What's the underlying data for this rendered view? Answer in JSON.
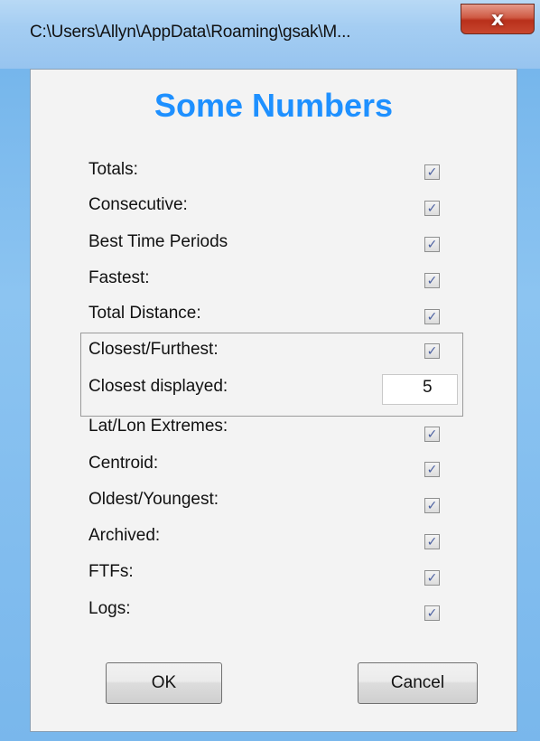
{
  "window": {
    "title": "C:\\Users\\Allyn\\AppData\\Roaming\\gsak\\M...",
    "close_label": "x"
  },
  "dialog": {
    "heading": "Some Numbers",
    "options": [
      {
        "label": "Totals:",
        "checked": true
      },
      {
        "label": "Consecutive:",
        "checked": true
      },
      {
        "label": "Best Time Periods",
        "checked": true
      },
      {
        "label": "Fastest:",
        "checked": true
      },
      {
        "label": "Total Distance:",
        "checked": true
      },
      {
        "label": "Closest/Furthest:",
        "checked": true
      },
      {
        "label": "Lat/Lon Extremes:",
        "checked": true
      },
      {
        "label": "Centroid:",
        "checked": true
      },
      {
        "label": "Oldest/Youngest:",
        "checked": true
      },
      {
        "label": "Archived:",
        "checked": true
      },
      {
        "label": "FTFs:",
        "checked": true
      },
      {
        "label": "Logs:",
        "checked": true
      }
    ],
    "closest_displayed": {
      "label": "Closest displayed:",
      "value": "5"
    },
    "check_glyph": "✓",
    "ok_label": "OK",
    "cancel_label": "Cancel"
  },
  "colors": {
    "heading": "#1e90ff",
    "close_button": "#c8462e",
    "checkmark": "#4a5fa0"
  }
}
